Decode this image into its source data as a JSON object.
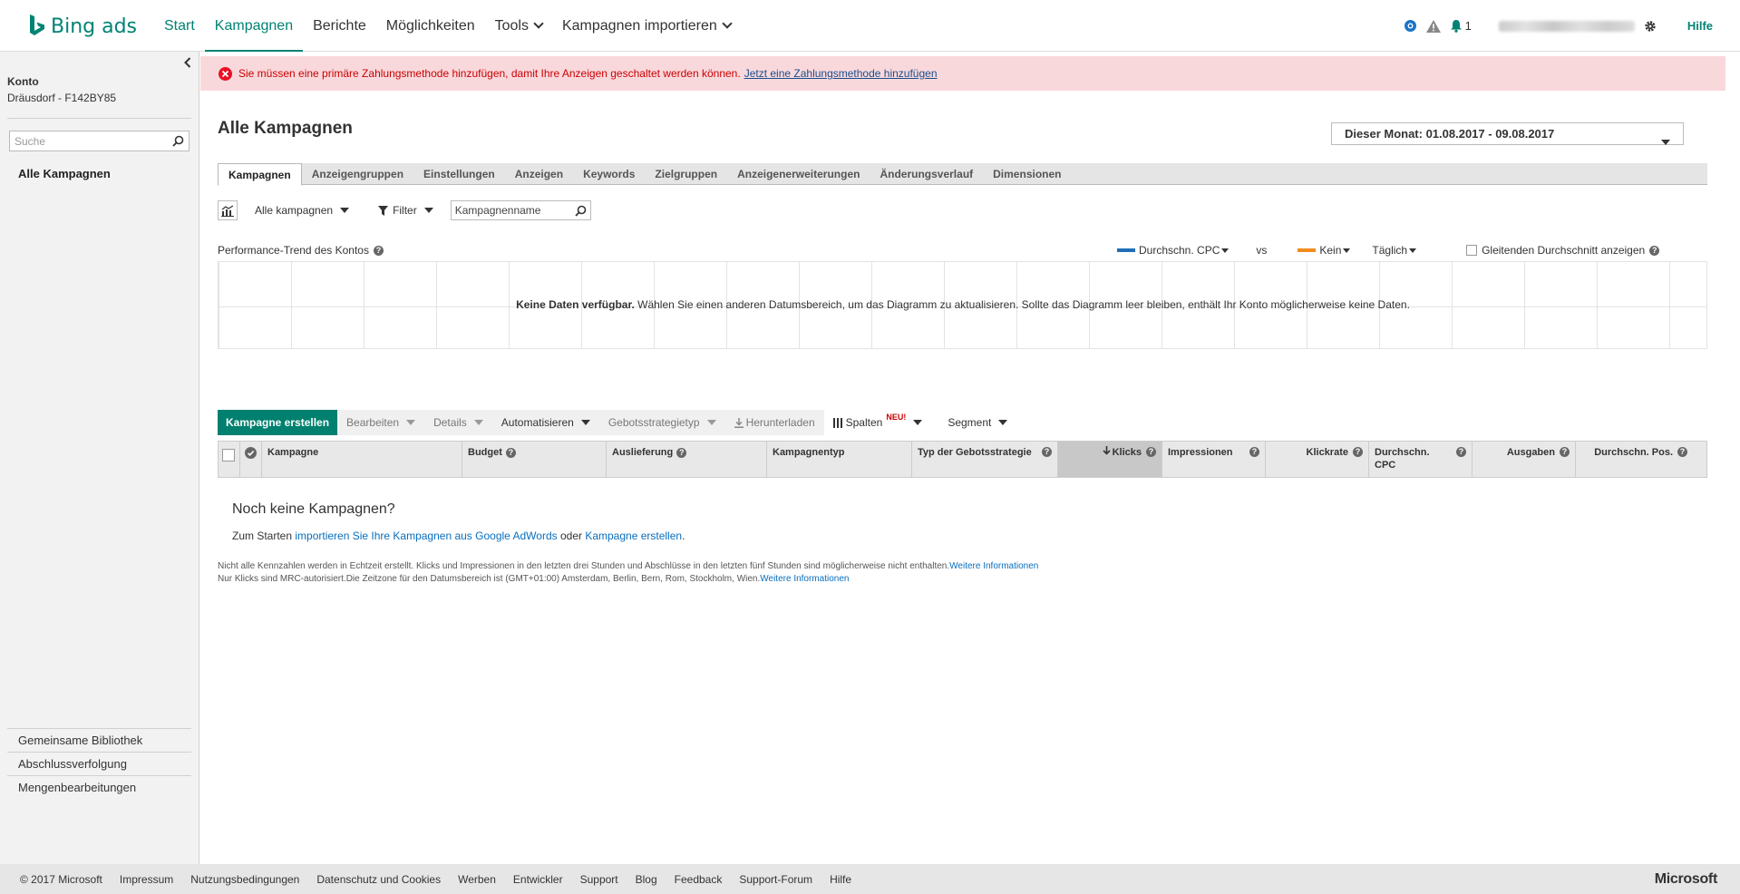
{
  "brand": {
    "name": "Bing ads",
    "color": "#008373"
  },
  "nav": {
    "items": [
      {
        "label": "Start"
      },
      {
        "label": "Kampagnen"
      },
      {
        "label": "Berichte"
      },
      {
        "label": "Möglichkeiten"
      },
      {
        "label": "Tools"
      },
      {
        "label": "Kampagnen importieren"
      }
    ],
    "notification_count": "1",
    "help": "Hilfe"
  },
  "sidebar": {
    "account_label": "Konto",
    "account_value": "Dräusdorf - F142BY85",
    "search_placeholder": "Suche",
    "all_campaigns": "Alle Kampagnen",
    "links": [
      "Gemeinsame Bibliothek",
      "Abschlussverfolgung",
      "Mengenbearbeitungen"
    ]
  },
  "alert": {
    "message": "Sie müssen eine primäre Zahlungsmethode hinzufügen, damit Ihre Anzeigen geschaltet werden können.",
    "link": "Jetzt eine Zahlungsmethode hinzufügen"
  },
  "page": {
    "title": "Alle Kampagnen",
    "date_range": "Dieser Monat: 01.08.2017 - 09.08.2017"
  },
  "tabs": [
    "Kampagnen",
    "Anzeigengruppen",
    "Einstellungen",
    "Anzeigen",
    "Keywords",
    "Zielgruppen",
    "Anzeigenerweiterungen",
    "Änderungsverlauf",
    "Dimensionen"
  ],
  "filters": {
    "scope": "Alle kampagnen",
    "filter": "Filter",
    "name_placeholder": "Kampagnenname"
  },
  "chart": {
    "label": "Performance-Trend des Kontos",
    "metric1": "Durchschn. CPC",
    "metric1_color": "#1f6fb5",
    "vs": "vs",
    "metric2": "Kein",
    "metric2_color": "#f28c1e",
    "interval": "Täglich",
    "moving_avg": "Gleitenden Durchschnitt anzeigen",
    "no_data_bold": "Keine Daten verfügbar.",
    "no_data_text": " Wählen Sie einen anderen Datumsbereich, um das Diagramm zu aktualisieren. Sollte das Diagramm leer bleiben, enthält Ihr Konto möglicherweise keine Daten."
  },
  "actions": {
    "create": "Kampagne erstellen",
    "edit": "Bearbeiten",
    "details": "Details",
    "automate": "Automatisieren",
    "bid_strategy": "Gebotsstrategietyp",
    "download": "Herunterladen",
    "columns": "Spalten",
    "columns_badge": "NEU!",
    "segment": "Segment"
  },
  "table": {
    "columns": [
      "Kampagne",
      "Budget",
      "Auslieferung",
      "Kampagnentyp",
      "Typ der Gebotsstrategie",
      "Klicks",
      "Impressionen",
      "Klickrate",
      "Durchschn. CPC",
      "Ausgaben",
      "Durchschn. Pos."
    ]
  },
  "empty": {
    "title": "Noch keine Kampagnen?",
    "prefix": "Zum Starten ",
    "import_link": "importieren Sie Ihre Kampagnen aus Google AdWords",
    "or": " oder ",
    "create_link": "Kampagne erstellen",
    "suffix": "."
  },
  "notes": {
    "line1": "Nicht alle Kennzahlen werden in Echtzeit erstellt. Klicks und Impressionen in den letzten drei Stunden und Abschlüsse in den letzten fünf Stunden sind möglicherweise nicht enthalten.",
    "line2": "Nur Klicks sind MRC-autorisiert.Die Zeitzone für den Datumsbereich ist (GMT+01:00) Amsterdam, Berlin, Bern, Rom, Stockholm, Wien.",
    "more": "Weitere Informationen"
  },
  "footer": {
    "items": [
      "© 2017 Microsoft",
      "Impressum",
      "Nutzungsbedingungen",
      "Datenschutz und Cookies",
      "Werben",
      "Entwickler",
      "Support",
      "Blog",
      "Feedback",
      "Support-Forum",
      "Hilfe"
    ],
    "brand": "Microsoft"
  }
}
